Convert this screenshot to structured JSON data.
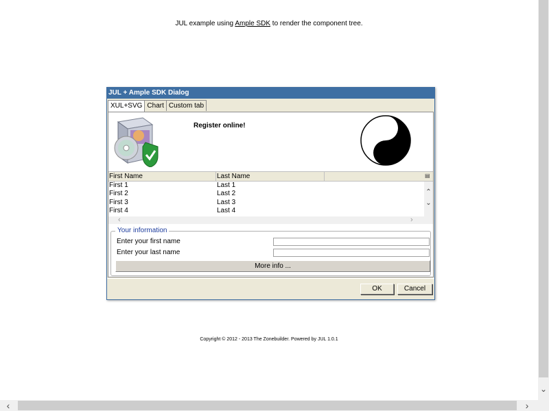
{
  "page": {
    "intro_before": "JUL example using ",
    "intro_link": "Ample SDK",
    "intro_after": " to render the component tree.",
    "footer": "Copyright © 2012 - 2013 The Zonebuilder. Powered by JUL 1.0.1"
  },
  "dialog": {
    "title": "JUL + Ample SDK Dialog",
    "tabs": [
      {
        "label": "XUL+SVG",
        "selected": true
      },
      {
        "label": "Chart",
        "selected": false
      },
      {
        "label": "Custom tab",
        "selected": false
      }
    ],
    "register_text": "Register online!",
    "list": {
      "columns": [
        "First Name",
        "Last Name"
      ],
      "rows": [
        [
          "First 1",
          "Last 1"
        ],
        [
          "First 2",
          "Last 2"
        ],
        [
          "First 3",
          "Last 3"
        ],
        [
          "First 4",
          "Last 4"
        ]
      ]
    },
    "group": {
      "legend": "Your information",
      "first_name_label": "Enter your first name",
      "first_name_value": "",
      "last_name_label": "Enter your last name",
      "last_name_value": "",
      "more_info_label": "More info ..."
    },
    "ok_label": "OK",
    "cancel_label": "Cancel"
  },
  "colors": {
    "titlebar": "#3e6fa3",
    "dialog_bg": "#ece9d8",
    "legend_text": "#1a3a9c"
  },
  "icons": [
    "software-box-icon",
    "shield-check-icon",
    "yin-yang-icon"
  ]
}
